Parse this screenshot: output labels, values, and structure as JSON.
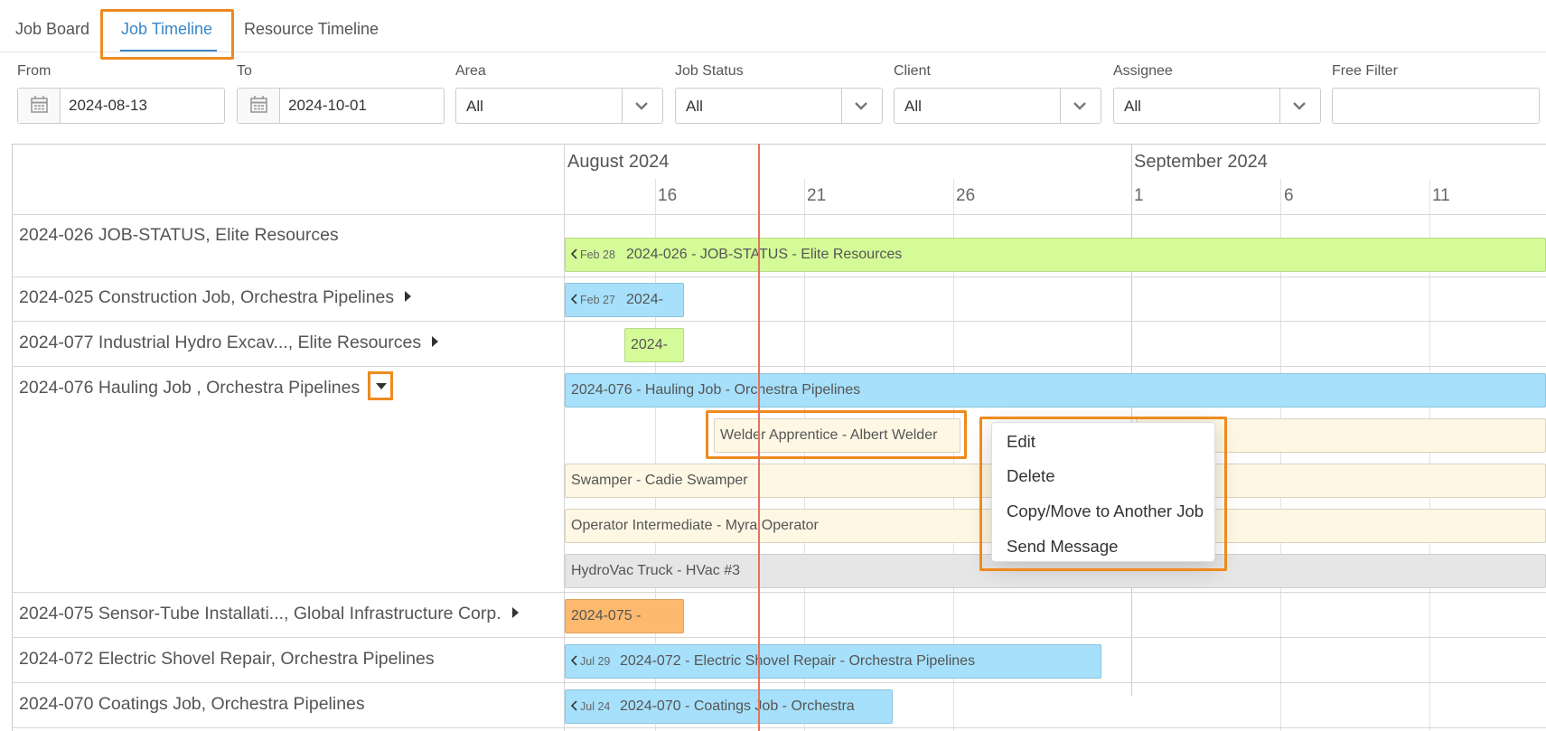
{
  "tabs": [
    {
      "label": "Job Board",
      "active": false
    },
    {
      "label": "Job Timeline",
      "active": true
    },
    {
      "label": "Resource Timeline",
      "active": false
    }
  ],
  "filters": {
    "from": {
      "label": "From",
      "value": "2024-08-13"
    },
    "to": {
      "label": "To",
      "value": "2024-10-01"
    },
    "area": {
      "label": "Area",
      "value": "All"
    },
    "job_status": {
      "label": "Job Status",
      "value": "All"
    },
    "client": {
      "label": "Client",
      "value": "All"
    },
    "assignee": {
      "label": "Assignee",
      "value": "All"
    },
    "free_filter": {
      "label": "Free Filter",
      "value": ""
    }
  },
  "timeline": {
    "months": [
      "August 2024",
      "September 2024"
    ],
    "days": [
      "16",
      "21",
      "26",
      "1",
      "6",
      "11"
    ]
  },
  "rows": [
    {
      "label": "2024-026 JOB-STATUS, Elite Resources"
    },
    {
      "label": "2024-025 Construction Job, Orchestra Pipelines"
    },
    {
      "label": "2024-077 Industrial Hydro Excav..., Elite Resources"
    },
    {
      "label": "2024-076 Hauling Job , Orchestra Pipelines"
    },
    {
      "label": "2024-075 Sensor-Tube Installati..., Global Infrastructure Corp."
    },
    {
      "label": "2024-072 Electric Shovel Repair, Orchestra Pipelines"
    },
    {
      "label": "2024-070 Coatings Job, Orchestra Pipelines"
    }
  ],
  "bars": {
    "job_026": {
      "start": "Feb 28",
      "label": "2024-026 - JOB-STATUS - Elite Resources"
    },
    "job_025": {
      "start": "Feb 27",
      "label": "2024-"
    },
    "job_077": {
      "label": "2024-"
    },
    "job_076": {
      "label": "2024-076 - Hauling Job - Orchestra Pipelines"
    },
    "welder": {
      "label": "Welder Apprentice - Albert Welder"
    },
    "swamper": {
      "label": "Swamper - Cadie Swamper"
    },
    "operator": {
      "label": "Operator Intermediate - Myra Operator"
    },
    "hydrovac": {
      "label": "HydroVac Truck - HVac #3"
    },
    "job_075": {
      "label": "2024-075 -"
    },
    "job_072": {
      "start": "Jul 29",
      "label": "2024-072 - Electric Shovel Repair - Orchestra Pipelines"
    },
    "job_070": {
      "start": "Jul 24",
      "label": "2024-070 - Coatings Job - Orchestra"
    }
  },
  "context_menu": {
    "items": [
      "Edit",
      "Delete",
      "Copy/Move to Another Job",
      "Send Message"
    ]
  },
  "colors": {
    "accent": "#3a86c8",
    "highlight": "#ee8a1f",
    "today_line": "#e8725f",
    "green_bar": "#d4fb98",
    "blue_bar": "#a6e0fb",
    "cream_bar": "#fdf7e4",
    "grey_bar": "#e6e6e6",
    "orange_bar": "#fdb96e"
  }
}
